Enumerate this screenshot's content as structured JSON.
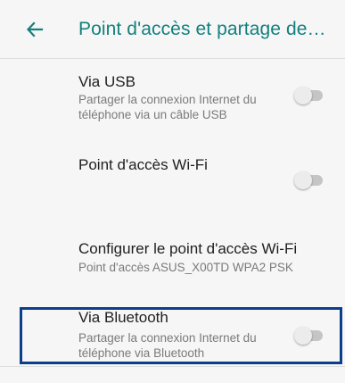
{
  "header": {
    "back_icon": "arrow-left-icon",
    "title": "Point d'accès et partage de…"
  },
  "colors": {
    "accent": "#13807e",
    "highlight_border": "#0b3f8c",
    "background": "#f6f6f6"
  },
  "rows": [
    {
      "title": "Via USB",
      "subtitle_line1": "Partager la connexion Internet du",
      "subtitle_line2": "téléphone via un câble USB",
      "toggle_on": false
    },
    {
      "title": "Point d'accès Wi-Fi",
      "toggle_on": false
    },
    {
      "title": "Configurer le point d'accès Wi-Fi",
      "subtitle_line1": "Point d'accès ASUS_X00TD WPA2 PSK"
    },
    {
      "title": "Via Bluetooth",
      "subtitle_line1": "Partager la connexion Internet du",
      "subtitle_line2": "téléphone via Bluetooth",
      "toggle_on": false
    }
  ]
}
